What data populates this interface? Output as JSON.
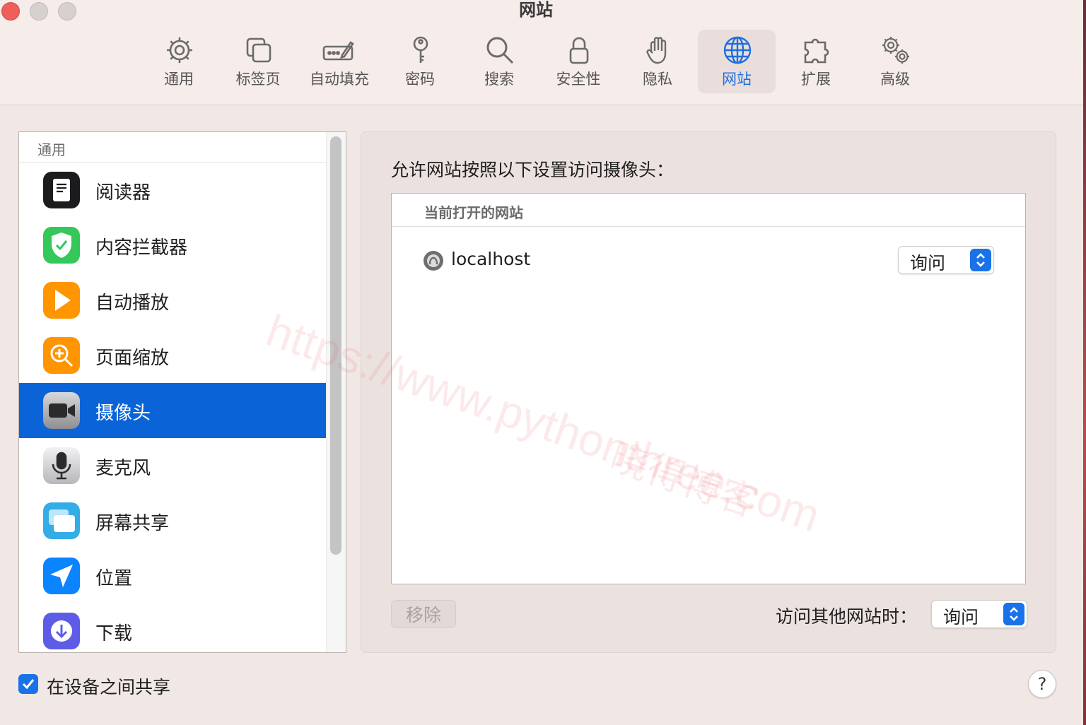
{
  "window": {
    "title": "网站"
  },
  "toolbar": {
    "tabs": [
      {
        "label": "通用",
        "icon": "gear-icon"
      },
      {
        "label": "标签页",
        "icon": "tabs-icon"
      },
      {
        "label": "自动填充",
        "icon": "autofill-icon"
      },
      {
        "label": "密码",
        "icon": "key-icon"
      },
      {
        "label": "搜索",
        "icon": "search-icon"
      },
      {
        "label": "安全性",
        "icon": "lock-icon"
      },
      {
        "label": "隐私",
        "icon": "hand-icon"
      },
      {
        "label": "网站",
        "icon": "globe-icon",
        "active": true
      },
      {
        "label": "扩展",
        "icon": "puzzle-icon"
      },
      {
        "label": "高级",
        "icon": "gears-icon"
      }
    ]
  },
  "sidebar": {
    "header": "通用",
    "items": [
      {
        "label": "阅读器",
        "icon": "reader-icon",
        "color": "#1c1c1e"
      },
      {
        "label": "内容拦截器",
        "icon": "shield-check-icon",
        "color": "#34c759"
      },
      {
        "label": "自动播放",
        "icon": "play-icon",
        "color": "#ff9500"
      },
      {
        "label": "页面缩放",
        "icon": "zoom-icon",
        "color": "#ff9500"
      },
      {
        "label": "摄像头",
        "icon": "camera-icon",
        "color": "#8e8e93",
        "selected": true
      },
      {
        "label": "麦克风",
        "icon": "microphone-icon",
        "color": "#d1d1d6"
      },
      {
        "label": "屏幕共享",
        "icon": "screen-share-icon",
        "color": "#32ade6"
      },
      {
        "label": "位置",
        "icon": "location-icon",
        "color": "#0a84ff"
      },
      {
        "label": "下载",
        "icon": "download-icon",
        "color": "#5e5ce6"
      }
    ]
  },
  "panel": {
    "heading": "允许网站按照以下设置访问摄像头：",
    "table_header": "当前打开的网站",
    "sites": [
      {
        "name": "localhost",
        "setting": "询问"
      }
    ],
    "remove_label": "移除",
    "other_sites_label": "访问其他网站时：",
    "other_sites_setting": "询问"
  },
  "footer": {
    "share_label": "在设备之间共享",
    "share_checked": true,
    "help_label": "?"
  },
  "watermark": {
    "url": "https://www.pythonthree.com",
    "name": "晓得博客"
  },
  "colors": {
    "accent": "#1a72e8",
    "selection": "#0a64d8"
  }
}
